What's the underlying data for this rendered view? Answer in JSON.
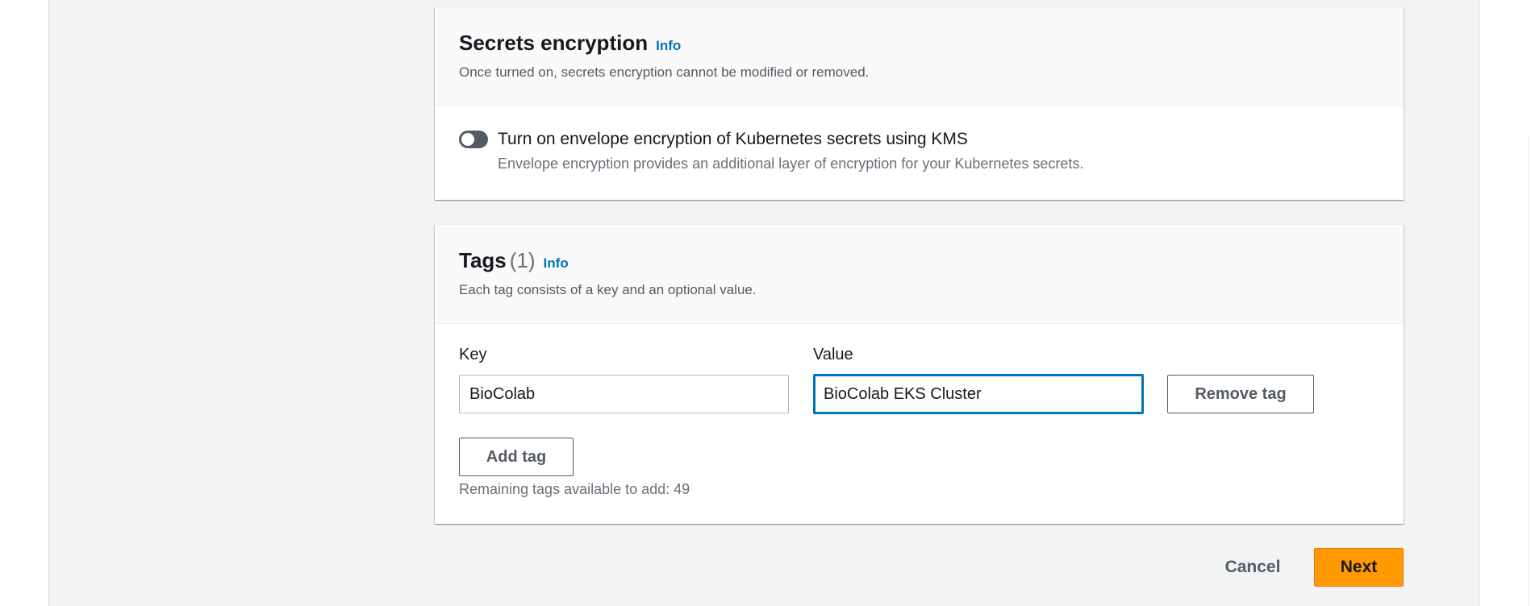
{
  "secrets": {
    "title": "Secrets encryption",
    "info_label": "Info",
    "description": "Once turned on, secrets encryption cannot be modified or removed.",
    "toggle": {
      "label": "Turn on envelope encryption of Kubernetes secrets using KMS",
      "description": "Envelope encryption provides an additional layer of encryption for your Kubernetes secrets.",
      "checked": false
    }
  },
  "tags": {
    "title": "Tags",
    "count": "(1)",
    "info_label": "Info",
    "description": "Each tag consists of a key and an optional value.",
    "key_label": "Key",
    "value_label": "Value",
    "rows": [
      {
        "key": "BioColab",
        "value": "BioColab EKS Cluster"
      }
    ],
    "remove_label": "Remove tag",
    "add_label": "Add tag",
    "remaining_text": "Remaining tags available to add: 49"
  },
  "footer": {
    "cancel_label": "Cancel",
    "next_label": "Next"
  },
  "colors": {
    "primary": "#ff9900",
    "link": "#0073bb",
    "focus": "#0073bb"
  }
}
